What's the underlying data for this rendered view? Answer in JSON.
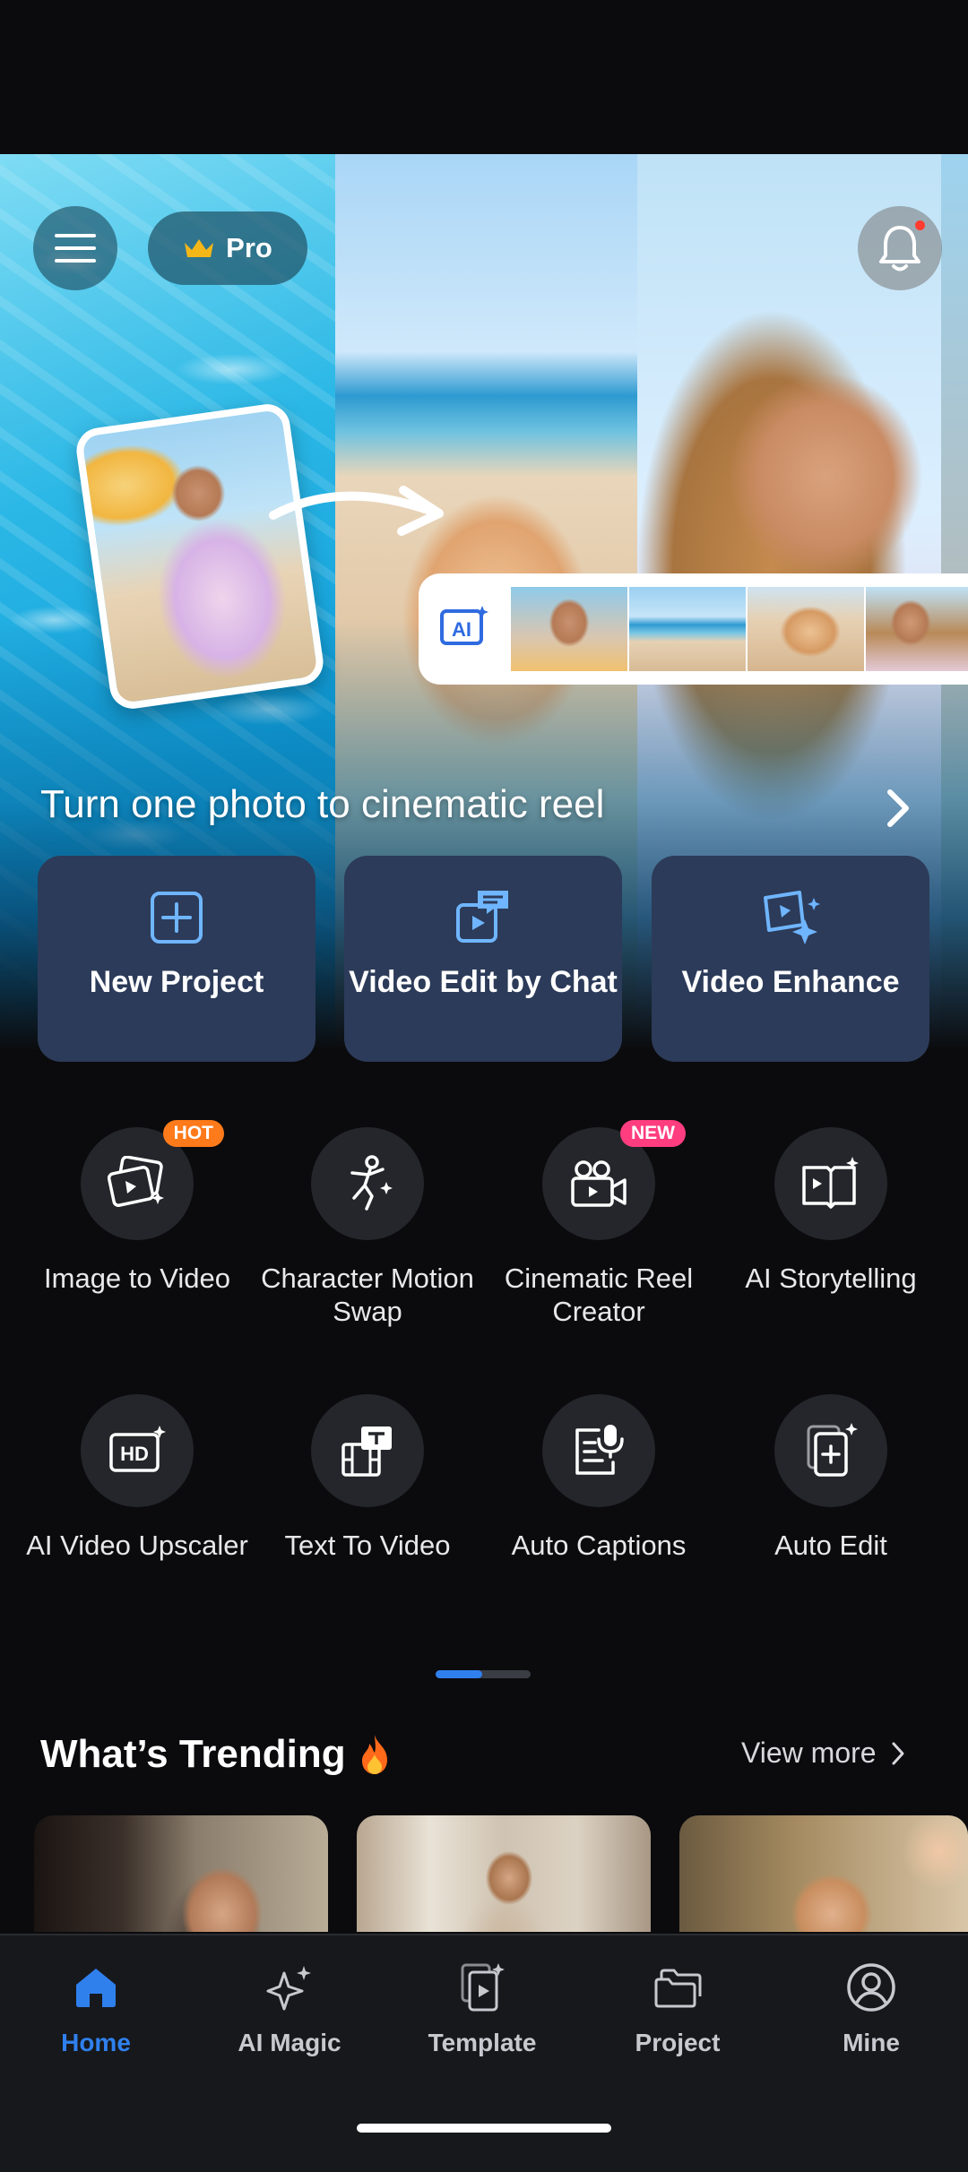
{
  "header": {
    "pro_label": "Pro"
  },
  "hero": {
    "title": "Turn one photo to cinematic reel",
    "ai_badge": "AI"
  },
  "actions": [
    {
      "label": "New Project",
      "icon": "plus-square-icon"
    },
    {
      "label": "Video Edit by Chat",
      "icon": "chat-video-icon"
    },
    {
      "label": "Video Enhance",
      "icon": "sparkle-video-icon"
    }
  ],
  "tools": [
    {
      "label": "Image to Video",
      "icon": "image-to-video-icon",
      "badge": "HOT"
    },
    {
      "label": "Character Motion Swap",
      "icon": "dancing-figure-icon",
      "badge": ""
    },
    {
      "label": "Cinematic Reel Creator",
      "icon": "camera-icon",
      "badge": "NEW"
    },
    {
      "label": "AI Storytelling",
      "icon": "book-icon",
      "badge": ""
    },
    {
      "label": "AI Video Upscaler",
      "icon": "hd-icon",
      "badge": ""
    },
    {
      "label": "Text To Video",
      "icon": "text-film-icon",
      "badge": ""
    },
    {
      "label": "Auto Captions",
      "icon": "microphone-icon",
      "badge": ""
    },
    {
      "label": "Auto Edit",
      "icon": "auto-edit-icon",
      "badge": ""
    }
  ],
  "trending": {
    "title": "What’s Trending",
    "view_more": "View more"
  },
  "nav": [
    {
      "label": "Home",
      "icon": "home-icon",
      "active": true
    },
    {
      "label": "AI Magic",
      "icon": "sparkle-icon",
      "active": false
    },
    {
      "label": "Template",
      "icon": "template-icon",
      "active": false
    },
    {
      "label": "Project",
      "icon": "folder-icon",
      "active": false
    },
    {
      "label": "Mine",
      "icon": "user-icon",
      "active": false
    }
  ],
  "colors": {
    "accent": "#2f80ed",
    "card": "#2c3b59",
    "hot": "#ff7a1a",
    "new": "#ff3d7f",
    "background": "#0b0b0d"
  }
}
